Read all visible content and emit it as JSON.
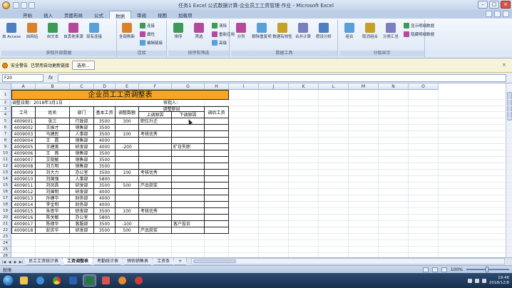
{
  "window": {
    "title": "任务1 Excel 公式数据计算-企业员工工资管理 作业 - Microsoft Excel"
  },
  "ribbon_tabs": [
    "开始",
    "插入",
    "页面布局",
    "公式",
    "数据",
    "审阅",
    "视图",
    "加载项"
  ],
  "active_tab": "数据",
  "ribbon_groups": [
    {
      "label": "获取外部数据",
      "buttons": [
        "自 Access",
        "自网站",
        "自文本",
        "自其他来源",
        "现有连接"
      ]
    },
    {
      "label": "连接",
      "buttons": [
        "全部刷新"
      ],
      "small": [
        "连接",
        "属性",
        "编辑链接"
      ]
    },
    {
      "label": "排序和筛选",
      "buttons": [
        "排序",
        "筛选"
      ],
      "small": [
        "清除",
        "重新应用",
        "高级"
      ]
    },
    {
      "label": "数据工具",
      "buttons": [
        "分列",
        "删除重复项",
        "数据有效性",
        "合并计算",
        "假设分析"
      ]
    },
    {
      "label": "分级显示",
      "buttons": [
        "组合",
        "取消组合",
        "分类汇总"
      ],
      "small": [
        "显示明细数据",
        "隐藏明细数据"
      ]
    }
  ],
  "security_bar": {
    "warning": "安全警告",
    "message": "已禁用自动更新链接",
    "options_button": "选项..."
  },
  "formula_bar": {
    "name_box": "F20",
    "fx": "fx",
    "formula": ""
  },
  "columns": [
    "A",
    "B",
    "C",
    "D",
    "E",
    "F",
    "G",
    "H",
    "I",
    "J",
    "K",
    "L",
    "M",
    "N",
    "O"
  ],
  "rows": [
    "1",
    "2",
    "3",
    "4",
    "5",
    "6",
    "7",
    "8",
    "9",
    "10",
    "11",
    "12",
    "13",
    "14",
    "15",
    "16",
    "17",
    "18",
    "19",
    "20",
    "21",
    "22",
    "23",
    "24",
    "25",
    "26"
  ],
  "sheet": {
    "title": "企业员工工资调整表",
    "date_label": "调整日期：2018年3月1日",
    "approver_label": "审批人：",
    "headers": {
      "id": "工号",
      "name": "姓名",
      "dept": "部门",
      "base": "基本工资",
      "adjust": "调整数额",
      "reason": "调整原因",
      "reason_up": "上调原因",
      "reason_down": "下调原因",
      "after": "调后工资"
    },
    "data_rows": [
      [
        "4009001",
        "张三",
        "行政部",
        "3500",
        "300",
        "职位升迁",
        ""
      ],
      [
        "4009002",
        "王振才",
        "销售部",
        "3500",
        "",
        "",
        ""
      ],
      [
        "4009003",
        "马建民",
        "人事部",
        "3500",
        "100",
        "考核优秀",
        ""
      ],
      [
        "4009004",
        "王　霞",
        "销售部",
        "4000",
        "",
        "",
        ""
      ],
      [
        "4009005",
        "王建美",
        "研发部",
        "4000",
        "-200",
        "",
        "旷日失职"
      ],
      [
        "4009006",
        "王　燕",
        "销售部",
        "3500",
        "",
        "",
        ""
      ],
      [
        "4009007",
        "艾晓敏",
        "销售部",
        "3500",
        "",
        "",
        ""
      ],
      [
        "4009008",
        "刘方明",
        "销售部",
        "3500",
        "",
        "",
        ""
      ],
      [
        "4009009",
        "刘大力",
        "办公室",
        "3500",
        "100",
        "考核优秀",
        ""
      ],
      [
        "4009010",
        "刘国强",
        "人事部",
        "5800",
        "",
        "",
        ""
      ],
      [
        "4009011",
        "刘凤昌",
        "研发部",
        "3500",
        "500",
        "产品获奖",
        ""
      ],
      [
        "4009012",
        "刘国明",
        "研发部",
        "4000",
        "",
        "",
        ""
      ],
      [
        "4009013",
        "孙建华",
        "财务部",
        "4000",
        "",
        "",
        ""
      ],
      [
        "4009014",
        "李金明",
        "财务部",
        "4000",
        "",
        "",
        ""
      ],
      [
        "4009015",
        "朱思华",
        "研发部",
        "3500",
        "100",
        "考核优秀",
        ""
      ],
      [
        "4009016",
        "陈关敏",
        "办公室",
        "5800",
        "",
        "",
        ""
      ],
      [
        "4009017",
        "陈德华",
        "客服部",
        "3500",
        "-100",
        "",
        "客户投诉"
      ],
      [
        "4009018",
        "彭庆华",
        "研发部",
        "3500",
        "500",
        "产品获奖",
        ""
      ]
    ]
  },
  "sheet_tabs": [
    "员工工资统计表",
    "工资调整表",
    "考勤统计表",
    "预估销售表",
    "工资条"
  ],
  "active_sheet": "工资调整表",
  "status": {
    "mode": "就绪",
    "zoom": "100%"
  },
  "taskbar": {
    "time": "19:46",
    "date": "2018/12/8"
  },
  "colors": {
    "title_fill": "#f5a623",
    "ribbon_bg": "#dce7f5",
    "taskbar": "#1d3a5f"
  }
}
